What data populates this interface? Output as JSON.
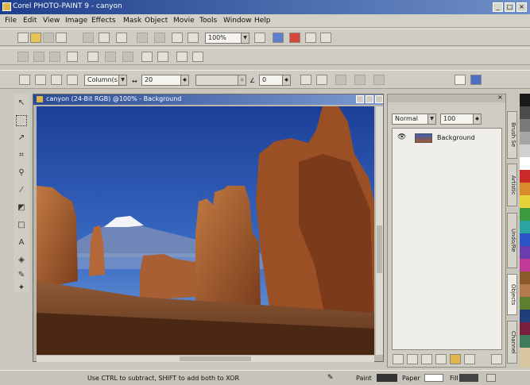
{
  "app": {
    "title": "Corel PHOTO-PAINT 9 - canyon"
  },
  "menu": [
    "File",
    "Edit",
    "View",
    "Image",
    "Effects",
    "Mask",
    "Object",
    "Movie",
    "Tools",
    "Window",
    "Help"
  ],
  "toolbar": {
    "zoom_value": "100%"
  },
  "property_bar": {
    "mode_value": "Column(s)",
    "width_value": "20",
    "transparency_value": "0"
  },
  "image_window": {
    "title": "canyon (24-Bit RGB) @100% - Background"
  },
  "layers": {
    "merge_mode": "Normal",
    "opacity": "100",
    "items": [
      {
        "name": "Background"
      }
    ]
  },
  "docker_tabs": [
    "Brush Se",
    "Artistic",
    "Undo/Re",
    "Objects",
    "Channel"
  ],
  "status": {
    "hint": "Use CTRL to subtract, SHIFT to add both to XOR",
    "paint_label": "Paint",
    "paper_label": "Paper",
    "fill_label": "Fill"
  },
  "colors": {
    "titlebar": "#1f3f8c",
    "ui": "#cfccc3",
    "sky": "#2c55b3",
    "rock": "#a2572a"
  }
}
